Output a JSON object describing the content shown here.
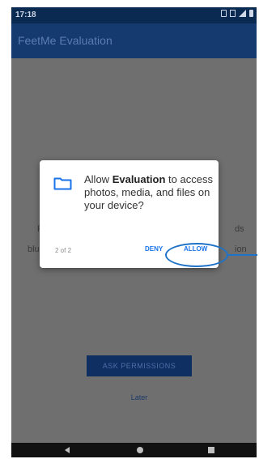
{
  "status_bar": {
    "time": "17:18"
  },
  "app_bar": {
    "title": "FeetMe Evaluation"
  },
  "background": {
    "partial_left_1": "Fe",
    "partial_right_1": "ds",
    "partial_left_2": "blu",
    "partial_right_2": "ion"
  },
  "ask_button": {
    "label": "ASK PERMISSIONS"
  },
  "later_link": {
    "label": "Later"
  },
  "dialog": {
    "prefix": "Allow ",
    "app_name": "Evaluation",
    "suffix": " to access photos, media, and files on your device?",
    "step": "2 of 2",
    "deny_label": "DENY",
    "allow_label": "ALLOW"
  },
  "colors": {
    "app_bar": "#153a70",
    "accent": "#1a73e8",
    "highlight": "#1e73c8"
  },
  "icons": {
    "dialog": "folder-icon",
    "nav": [
      "back-icon",
      "home-icon",
      "recents-icon"
    ]
  }
}
